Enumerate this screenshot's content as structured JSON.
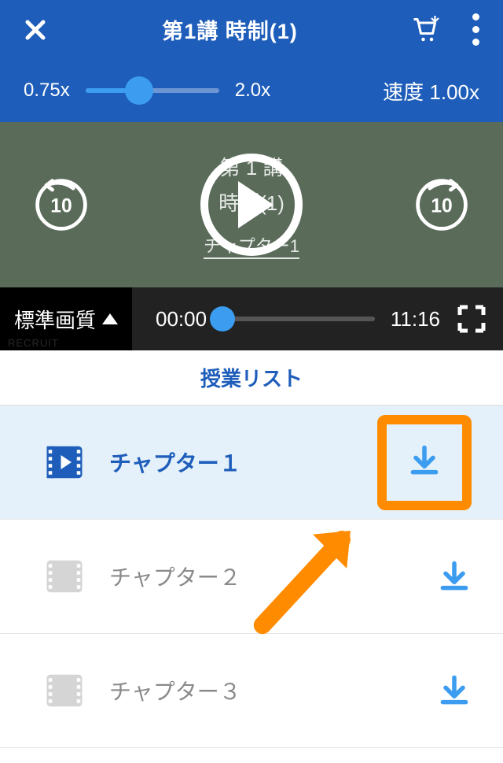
{
  "header": {
    "title": "第1講 時制(1)"
  },
  "speed": {
    "min_label": "0.75x",
    "max_label": "2.0x",
    "current_label": "速度 1.00x"
  },
  "video_overlay": {
    "line1": "第 1 講",
    "line2": "時制(1)",
    "chapter_link": "チャプター1"
  },
  "skip": {
    "seconds": "10"
  },
  "progress": {
    "quality_label": "標準画質",
    "current_time": "00:00",
    "duration": "11:16"
  },
  "watermark": "RECRUIT",
  "list": {
    "header": "授業リスト",
    "items": [
      {
        "label": "チャプター１",
        "active": true
      },
      {
        "label": "チャプター２",
        "active": false
      },
      {
        "label": "チャプター３",
        "active": false
      }
    ]
  },
  "colors": {
    "primary": "#1e5dba",
    "accent": "#3b9cf0",
    "highlight": "#ff8c00"
  }
}
